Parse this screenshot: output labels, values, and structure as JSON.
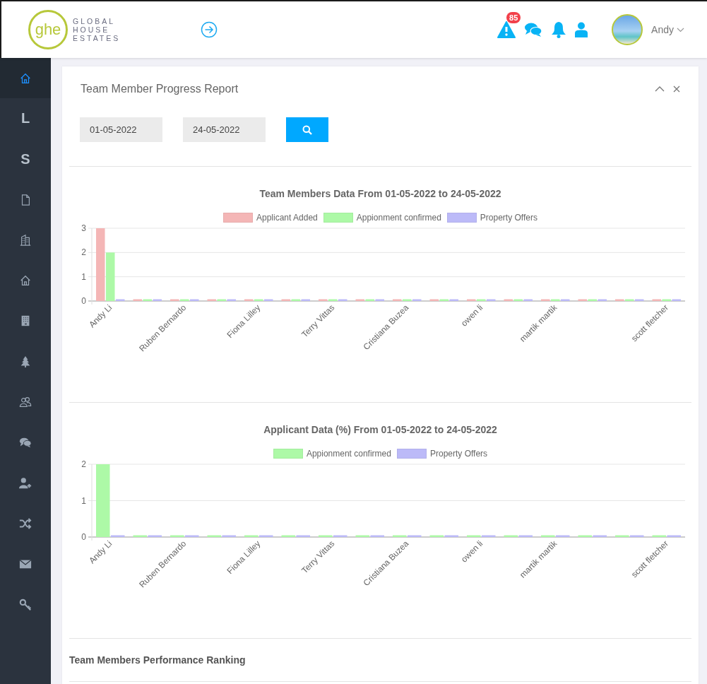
{
  "header": {
    "logo": {
      "mark": "ghe",
      "lines": [
        "GLOBAL",
        "HOUSE",
        "ESTATES"
      ]
    },
    "alert_count": "85",
    "user": {
      "name": "Andy"
    }
  },
  "sidebar": {
    "items": [
      {
        "selected": true
      },
      {
        "label": "L",
        "selected": false
      },
      {
        "label": "S",
        "selected": false
      },
      {
        "selected": false
      },
      {
        "selected": false
      },
      {
        "selected": false
      },
      {
        "selected": false
      },
      {
        "selected": false
      },
      {
        "selected": false
      },
      {
        "selected": false
      },
      {
        "selected": false
      },
      {
        "selected": false
      },
      {
        "selected": false
      },
      {
        "selected": false
      }
    ]
  },
  "report": {
    "title": "Team Member Progress Report",
    "date_from": "01-05-2022",
    "date_to": "24-05-2022",
    "charts": [
      {
        "chart_data": {
          "type": "bar",
          "legend": "top",
          "title": "Team Members Data From 01-05-2022 to 24-05-2022",
          "categories": [
            "Andy Li",
            null,
            "Ruben Bernardo",
            null,
            "Fiona Lilley",
            null,
            "Terry Vittas",
            null,
            "Cristiana Buzea",
            null,
            "owen li",
            null,
            "martik martik",
            null,
            null,
            "scott fletcher"
          ],
          "ylim": [
            0,
            3
          ],
          "yticks": [
            0,
            1,
            2,
            3
          ],
          "series": [
            {
              "name": "Applicant Added",
              "color": "#f4b6b6",
              "values": [
                3,
                0,
                0,
                0,
                0,
                0,
                0,
                0,
                0,
                0,
                0,
                0,
                0,
                0,
                0,
                0
              ]
            },
            {
              "name": "Appionment confirmed",
              "color": "#adf9a7",
              "values": [
                2,
                0,
                0,
                0,
                0,
                0,
                0,
                0,
                0,
                0,
                0,
                0,
                0,
                0,
                0,
                0
              ]
            },
            {
              "name": "Property Offers",
              "color": "#bcbaf8",
              "values": [
                0,
                0,
                0,
                0,
                0,
                0,
                0,
                0,
                0,
                0,
                0,
                0,
                0,
                0,
                0,
                0
              ]
            }
          ]
        }
      },
      {
        "chart_data": {
          "type": "bar",
          "legend": "top",
          "title": "Applicant Data (%) From 01-05-2022 to 24-05-2022",
          "categories": [
            "Andy Li",
            null,
            "Ruben Bernardo",
            null,
            "Fiona Lilley",
            null,
            "Terry Vittas",
            null,
            "Cristiana Buzea",
            null,
            "owen li",
            null,
            "martik martik",
            null,
            null,
            "scott fletcher"
          ],
          "ylim": [
            0,
            2
          ],
          "yticks": [
            0,
            1,
            2
          ],
          "series": [
            {
              "name": "Appionment confirmed",
              "color": "#adf9a7",
              "values": [
                2,
                0,
                0,
                0,
                0,
                0,
                0,
                0,
                0,
                0,
                0,
                0,
                0,
                0,
                0,
                0
              ]
            },
            {
              "name": "Property Offers",
              "color": "#bcbaf8",
              "values": [
                0,
                0,
                0,
                0,
                0,
                0,
                0,
                0,
                0,
                0,
                0,
                0,
                0,
                0,
                0,
                0
              ]
            }
          ]
        }
      }
    ],
    "ranking_title": "Team Members Performance Ranking"
  }
}
